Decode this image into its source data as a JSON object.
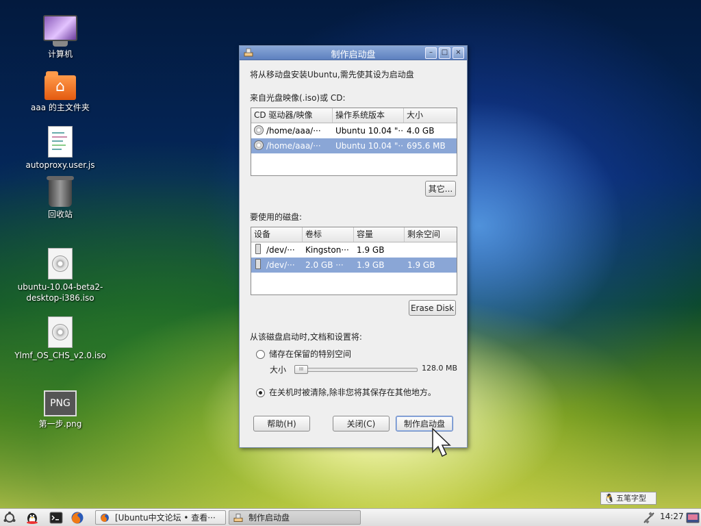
{
  "desktop": {
    "icons": [
      {
        "label": "计算机"
      },
      {
        "label": "aaa 的主文件夹"
      },
      {
        "label": "autoproxy.user.js"
      },
      {
        "label": "回收站"
      },
      {
        "label": "ubuntu-10.04-beta2-desktop-i386.iso"
      },
      {
        "label": "Ylmf_OS_CHS_v2.0.iso"
      },
      {
        "label": "第一步.png",
        "badge": "PNG"
      }
    ]
  },
  "dialog": {
    "title": "制作启动盘",
    "intro": "将从移动盘安装Ubuntu,需先使其设为启动盘",
    "source_label": "来自光盘映像(.iso)或 CD:",
    "source_table": {
      "headers": [
        "CD 驱动器/映像",
        "操作系统版本",
        "大小"
      ],
      "rows": [
        {
          "path": "/home/aaa/···",
          "version": "Ubuntu 10.04 \"···",
          "size": "4.0 GB",
          "selected": false
        },
        {
          "path": "/home/aaa/···",
          "version": "Ubuntu 10.04 \"···",
          "size": "695.6 MB",
          "selected": true
        }
      ]
    },
    "other_button": "其它...",
    "disk_label": "要使用的磁盘:",
    "disk_table": {
      "headers": [
        "设备",
        "卷标",
        "容量",
        "剩余空间"
      ],
      "rows": [
        {
          "device": "/dev/···",
          "label": "Kingston···",
          "capacity": "1.9 GB",
          "free": "",
          "selected": false
        },
        {
          "device": "/dev/···",
          "label": "2.0 GB ···",
          "capacity": "1.9 GB",
          "free": "1.9 GB",
          "selected": true
        }
      ]
    },
    "erase_button": "Erase Disk",
    "persist_label": "从该磁盘启动时,文档和设置将:",
    "option_reserve": "储存在保留的特别空间",
    "size_label": "大小",
    "size_value": "128.0 MB",
    "option_discard": "在关机时被清除,除非您将其保存在其他地方。",
    "selected_option": "discard",
    "help_button": "帮助(H)",
    "close_button": "关闭(C)",
    "make_button": "制作启动盘"
  },
  "taskbar": {
    "tasks": [
      {
        "label": "[Ubuntu中文论坛 • 查看···",
        "active": false
      },
      {
        "label": "制作启动盘",
        "active": true
      }
    ],
    "clock": "14:27"
  },
  "ime": {
    "label": "五笔字型"
  },
  "colors": {
    "title_bar": "#6d8ecb",
    "selection": "#8aa6d6"
  }
}
